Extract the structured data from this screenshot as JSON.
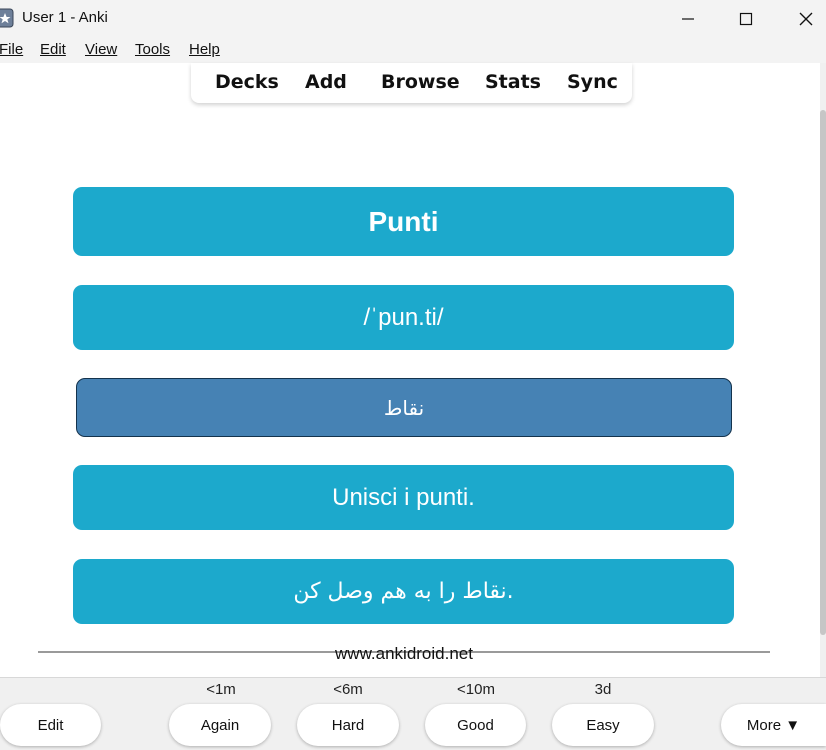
{
  "window": {
    "title": "User 1 - Anki",
    "minimize_icon": "minimize-icon",
    "maximize_icon": "maximize-icon",
    "close_icon": "close-icon"
  },
  "menu": {
    "items": [
      {
        "label": "File"
      },
      {
        "label": "Edit"
      },
      {
        "label": "View"
      },
      {
        "label": "Tools"
      },
      {
        "label": "Help"
      }
    ]
  },
  "toolbar": {
    "items": [
      {
        "label": "Decks"
      },
      {
        "label": "Add"
      },
      {
        "label": "Browse"
      },
      {
        "label": "Stats"
      },
      {
        "label": "Sync"
      }
    ]
  },
  "card": {
    "word": "Punti",
    "pronunciation": "/ˈpun.ti/",
    "translation": "نقاط",
    "example": "Unisci i punti.",
    "example_translation": ".نقاط را به هم وصل کن",
    "footer": "www.ankidroid.net"
  },
  "colors": {
    "card_bg": "#1ca9cc",
    "selected_bg": "#4682b4"
  },
  "answer_bar": {
    "edit": "Edit",
    "more": "More ▼",
    "buttons": [
      {
        "label": "Again",
        "interval": "<1m"
      },
      {
        "label": "Hard",
        "interval": "<6m"
      },
      {
        "label": "Good",
        "interval": "<10m"
      },
      {
        "label": "Easy",
        "interval": "3d"
      }
    ]
  }
}
